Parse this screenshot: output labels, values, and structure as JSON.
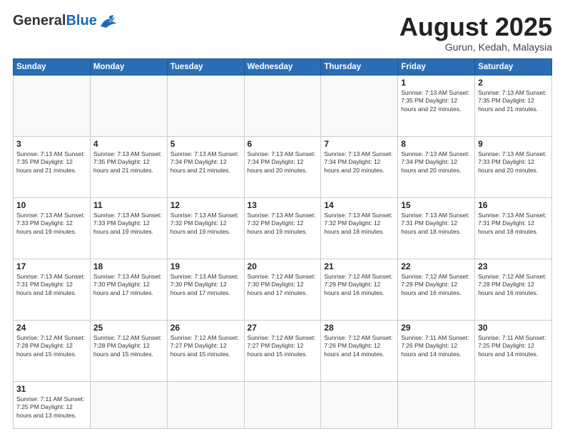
{
  "header": {
    "logo": {
      "general": "General",
      "blue": "Blue"
    },
    "title": "August 2025",
    "location": "Gurun, Kedah, Malaysia"
  },
  "weekdays": [
    "Sunday",
    "Monday",
    "Tuesday",
    "Wednesday",
    "Thursday",
    "Friday",
    "Saturday"
  ],
  "weeks": [
    [
      {
        "day": null,
        "info": null
      },
      {
        "day": null,
        "info": null
      },
      {
        "day": null,
        "info": null
      },
      {
        "day": null,
        "info": null
      },
      {
        "day": null,
        "info": null
      },
      {
        "day": "1",
        "info": "Sunrise: 7:13 AM\nSunset: 7:35 PM\nDaylight: 12 hours\nand 22 minutes."
      },
      {
        "day": "2",
        "info": "Sunrise: 7:13 AM\nSunset: 7:35 PM\nDaylight: 12 hours\nand 21 minutes."
      }
    ],
    [
      {
        "day": "3",
        "info": "Sunrise: 7:13 AM\nSunset: 7:35 PM\nDaylight: 12 hours\nand 21 minutes."
      },
      {
        "day": "4",
        "info": "Sunrise: 7:13 AM\nSunset: 7:35 PM\nDaylight: 12 hours\nand 21 minutes."
      },
      {
        "day": "5",
        "info": "Sunrise: 7:13 AM\nSunset: 7:34 PM\nDaylight: 12 hours\nand 21 minutes."
      },
      {
        "day": "6",
        "info": "Sunrise: 7:13 AM\nSunset: 7:34 PM\nDaylight: 12 hours\nand 20 minutes."
      },
      {
        "day": "7",
        "info": "Sunrise: 7:13 AM\nSunset: 7:34 PM\nDaylight: 12 hours\nand 20 minutes."
      },
      {
        "day": "8",
        "info": "Sunrise: 7:13 AM\nSunset: 7:34 PM\nDaylight: 12 hours\nand 20 minutes."
      },
      {
        "day": "9",
        "info": "Sunrise: 7:13 AM\nSunset: 7:33 PM\nDaylight: 12 hours\nand 20 minutes."
      }
    ],
    [
      {
        "day": "10",
        "info": "Sunrise: 7:13 AM\nSunset: 7:33 PM\nDaylight: 12 hours\nand 19 minutes."
      },
      {
        "day": "11",
        "info": "Sunrise: 7:13 AM\nSunset: 7:33 PM\nDaylight: 12 hours\nand 19 minutes."
      },
      {
        "day": "12",
        "info": "Sunrise: 7:13 AM\nSunset: 7:32 PM\nDaylight: 12 hours\nand 19 minutes."
      },
      {
        "day": "13",
        "info": "Sunrise: 7:13 AM\nSunset: 7:32 PM\nDaylight: 12 hours\nand 19 minutes."
      },
      {
        "day": "14",
        "info": "Sunrise: 7:13 AM\nSunset: 7:32 PM\nDaylight: 12 hours\nand 18 minutes."
      },
      {
        "day": "15",
        "info": "Sunrise: 7:13 AM\nSunset: 7:31 PM\nDaylight: 12 hours\nand 18 minutes."
      },
      {
        "day": "16",
        "info": "Sunrise: 7:13 AM\nSunset: 7:31 PM\nDaylight: 12 hours\nand 18 minutes."
      }
    ],
    [
      {
        "day": "17",
        "info": "Sunrise: 7:13 AM\nSunset: 7:31 PM\nDaylight: 12 hours\nand 18 minutes."
      },
      {
        "day": "18",
        "info": "Sunrise: 7:13 AM\nSunset: 7:30 PM\nDaylight: 12 hours\nand 17 minutes."
      },
      {
        "day": "19",
        "info": "Sunrise: 7:13 AM\nSunset: 7:30 PM\nDaylight: 12 hours\nand 17 minutes."
      },
      {
        "day": "20",
        "info": "Sunrise: 7:12 AM\nSunset: 7:30 PM\nDaylight: 12 hours\nand 17 minutes."
      },
      {
        "day": "21",
        "info": "Sunrise: 7:12 AM\nSunset: 7:29 PM\nDaylight: 12 hours\nand 16 minutes."
      },
      {
        "day": "22",
        "info": "Sunrise: 7:12 AM\nSunset: 7:29 PM\nDaylight: 12 hours\nand 16 minutes."
      },
      {
        "day": "23",
        "info": "Sunrise: 7:12 AM\nSunset: 7:28 PM\nDaylight: 12 hours\nand 16 minutes."
      }
    ],
    [
      {
        "day": "24",
        "info": "Sunrise: 7:12 AM\nSunset: 7:28 PM\nDaylight: 12 hours\nand 15 minutes."
      },
      {
        "day": "25",
        "info": "Sunrise: 7:12 AM\nSunset: 7:28 PM\nDaylight: 12 hours\nand 15 minutes."
      },
      {
        "day": "26",
        "info": "Sunrise: 7:12 AM\nSunset: 7:27 PM\nDaylight: 12 hours\nand 15 minutes."
      },
      {
        "day": "27",
        "info": "Sunrise: 7:12 AM\nSunset: 7:27 PM\nDaylight: 12 hours\nand 15 minutes."
      },
      {
        "day": "28",
        "info": "Sunrise: 7:12 AM\nSunset: 7:26 PM\nDaylight: 12 hours\nand 14 minutes."
      },
      {
        "day": "29",
        "info": "Sunrise: 7:11 AM\nSunset: 7:26 PM\nDaylight: 12 hours\nand 14 minutes."
      },
      {
        "day": "30",
        "info": "Sunrise: 7:11 AM\nSunset: 7:25 PM\nDaylight: 12 hours\nand 14 minutes."
      }
    ],
    [
      {
        "day": "31",
        "info": "Sunrise: 7:11 AM\nSunset: 7:25 PM\nDaylight: 12 hours\nand 13 minutes."
      },
      {
        "day": null,
        "info": null
      },
      {
        "day": null,
        "info": null
      },
      {
        "day": null,
        "info": null
      },
      {
        "day": null,
        "info": null
      },
      {
        "day": null,
        "info": null
      },
      {
        "day": null,
        "info": null
      }
    ]
  ]
}
